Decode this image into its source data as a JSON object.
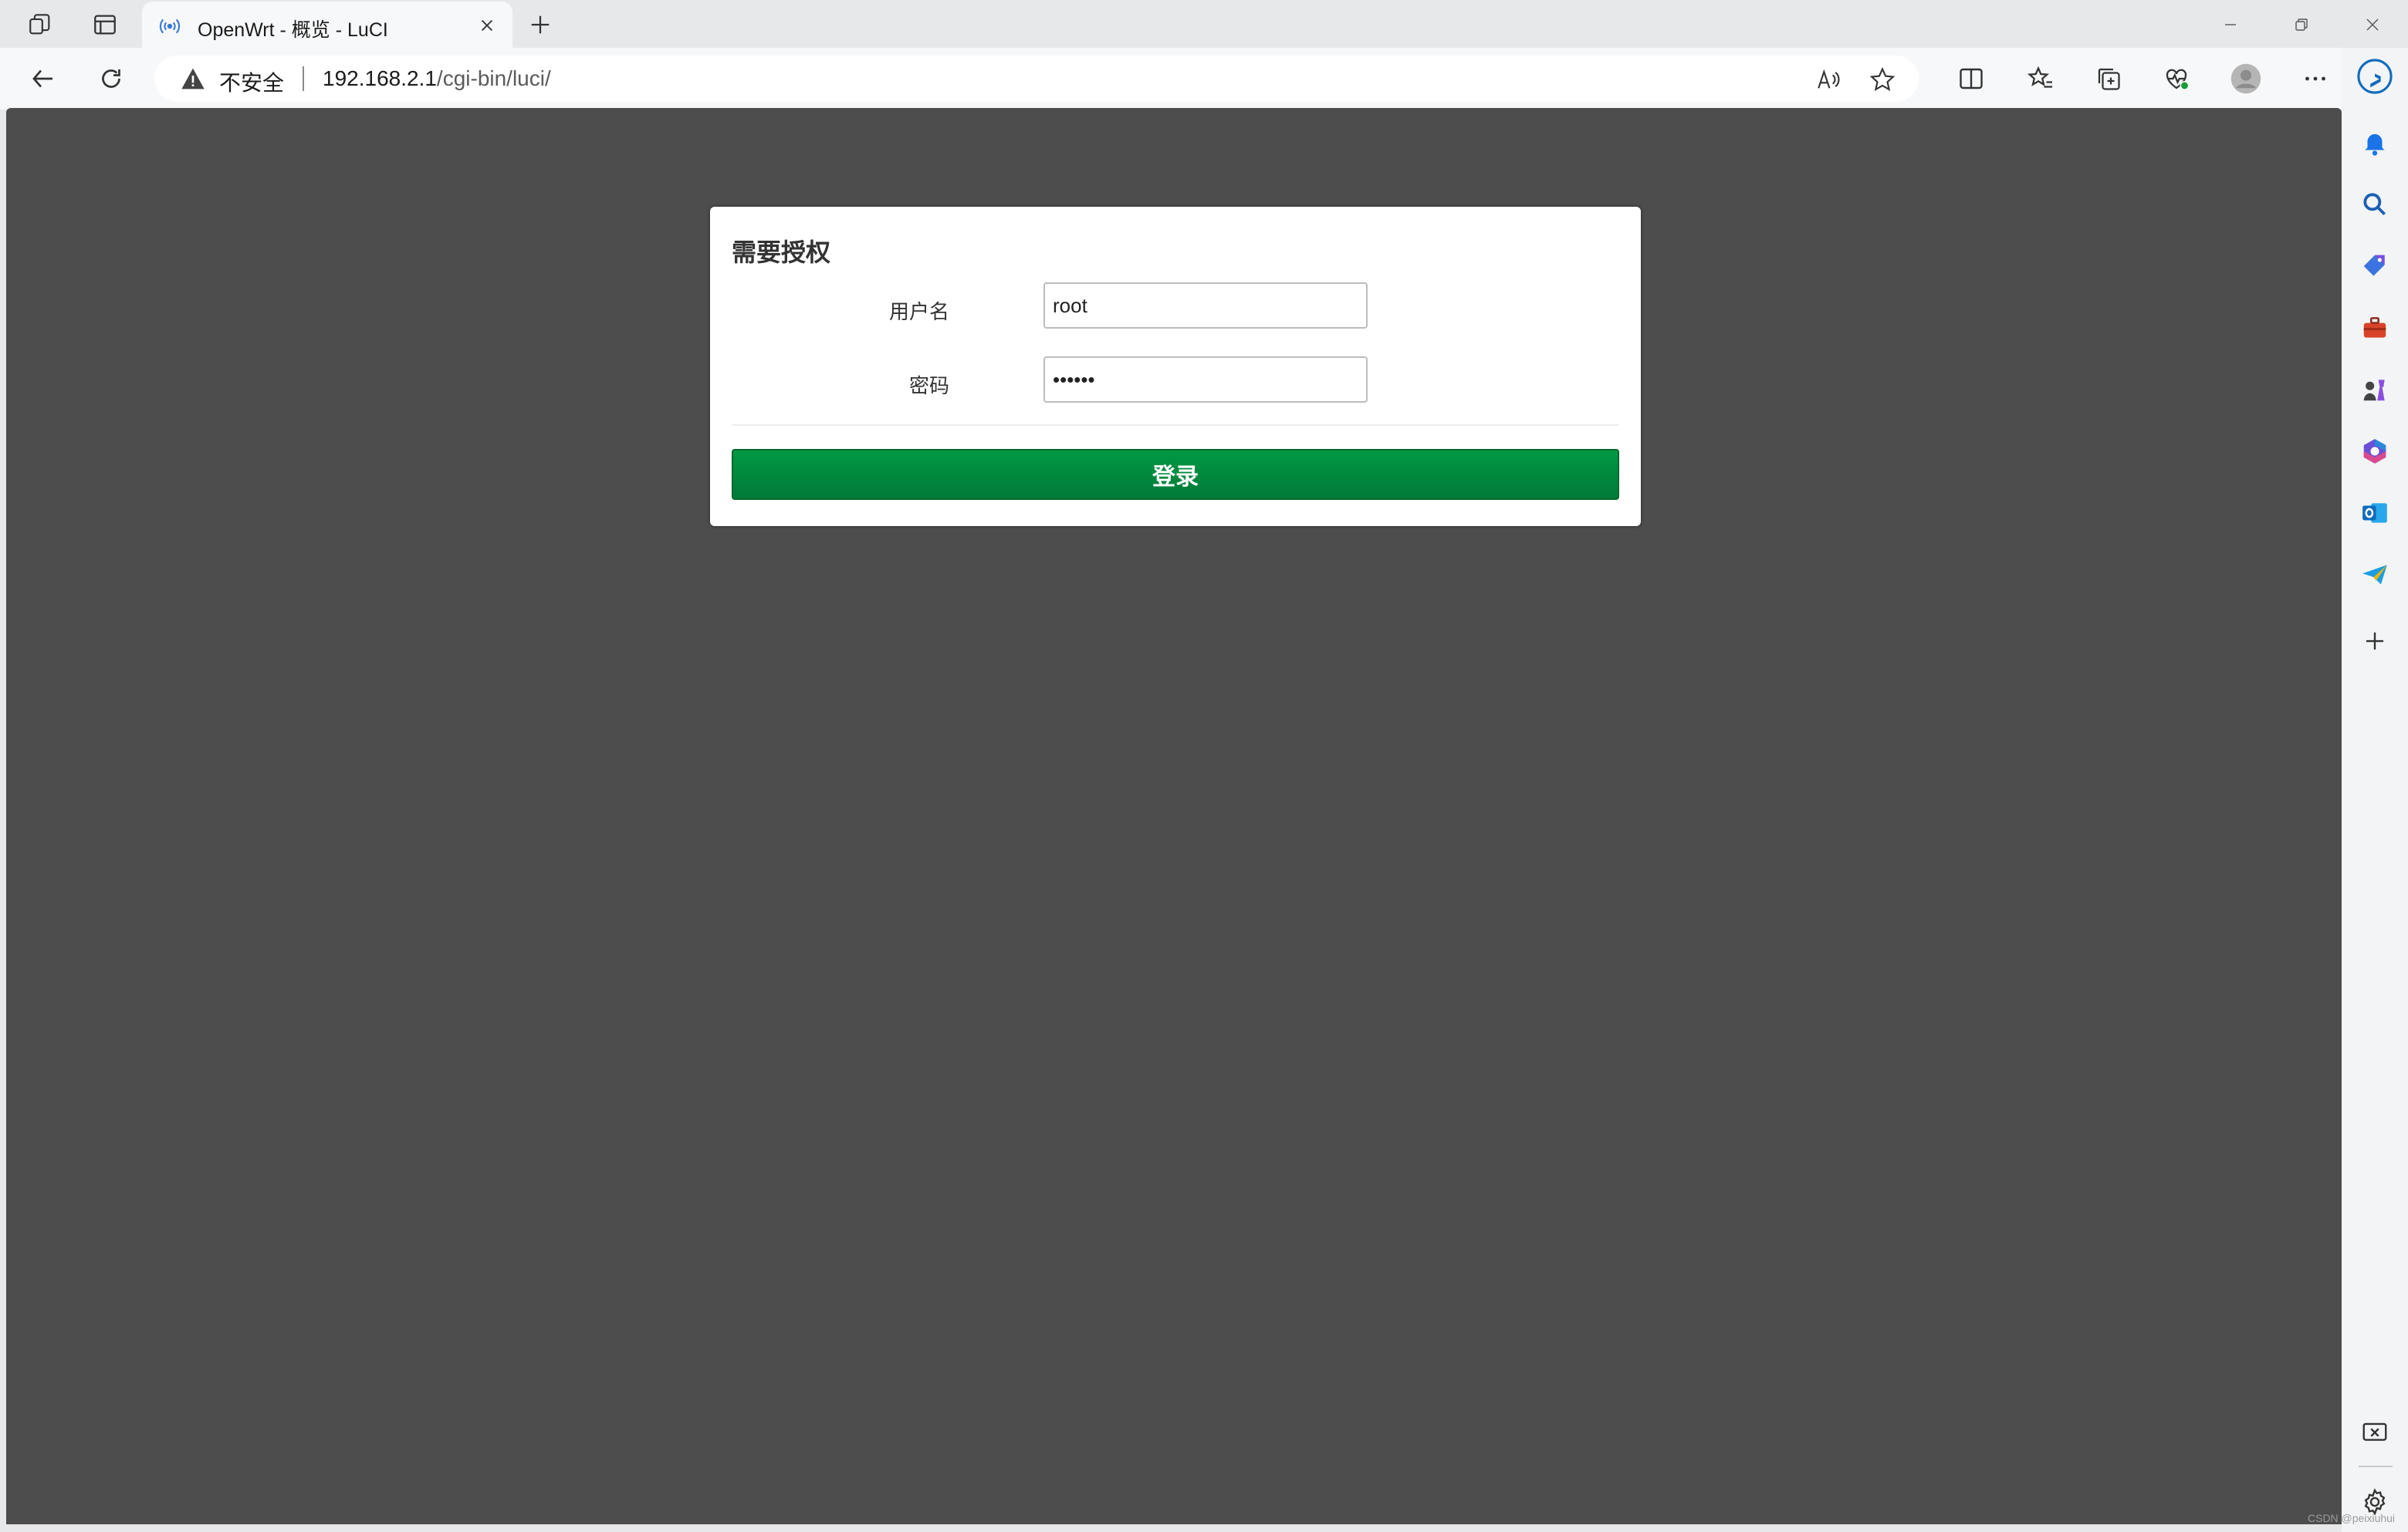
{
  "browser": {
    "tab": {
      "title": "OpenWrt - 概览 - LuCI"
    },
    "address": {
      "security_label": "不安全",
      "url_host": "192.168.2.1",
      "url_path": "/cgi-bin/luci/"
    },
    "colors": {
      "bing_accent": "#0f6cbd",
      "insecure_icon": "#444444"
    }
  },
  "login": {
    "title": "需要授权",
    "username_label": "用户名",
    "username_value": "root",
    "password_label": "密码",
    "password_value": "••••••",
    "submit_label": "登录",
    "colors": {
      "button": "#008c3f",
      "page_background": "#4d4d4d"
    }
  },
  "watermark": "CSDN @peixiuhui"
}
